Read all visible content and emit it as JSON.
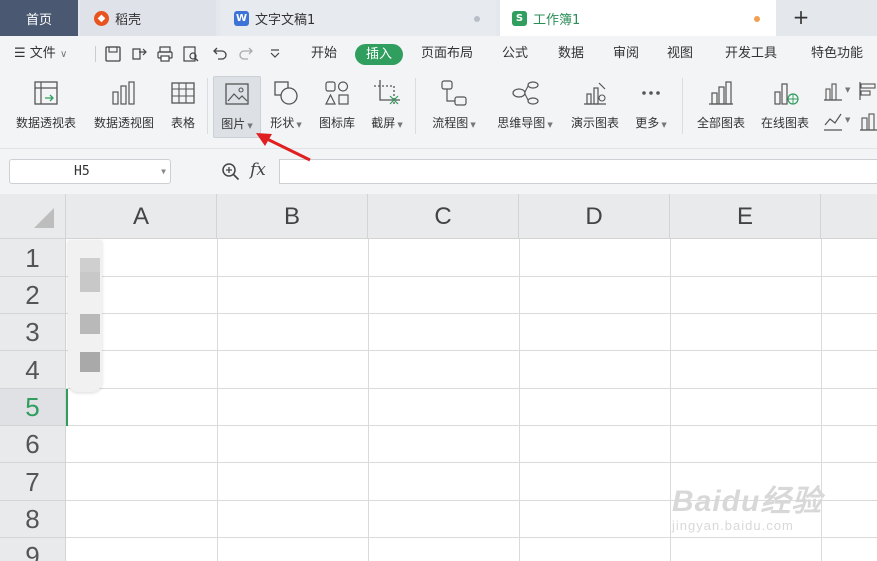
{
  "tabs": [
    {
      "label": "首页",
      "icon": "home"
    },
    {
      "label": "稻壳",
      "icon": "daoke-logo-icon",
      "icon_color": "#e8531f"
    },
    {
      "label": "文字文稿1",
      "icon": "writer-doc-icon",
      "icon_text": "W",
      "icon_color": "#3d73d6",
      "dot_color": "#b8bec7"
    },
    {
      "label": "工作簿1",
      "icon": "spreadsheet-icon",
      "icon_text": "S",
      "icon_color": "#2f9e5e",
      "dot_color": "#f0a050"
    }
  ],
  "tab_add_label": "+",
  "menu": {
    "file_label": "文件",
    "items": [
      "开始",
      "插入",
      "页面布局",
      "公式",
      "数据",
      "审阅",
      "视图",
      "开发工具",
      "特色功能"
    ],
    "active_item": "插入",
    "active_color": "#2f9e5e"
  },
  "ribbon": {
    "buttons": [
      {
        "label": "数据透视表",
        "icon": "pivot-table-icon"
      },
      {
        "label": "数据透视图",
        "icon": "pivot-chart-icon"
      },
      {
        "label": "表格",
        "icon": "table-icon"
      },
      {
        "label": "图片",
        "icon": "picture-icon",
        "has_dropdown": true
      },
      {
        "label": "形状",
        "icon": "shapes-icon",
        "has_dropdown": true
      },
      {
        "label": "图标库",
        "icon": "icon-library-icon"
      },
      {
        "label": "截屏",
        "icon": "screenshot-icon",
        "has_dropdown": true
      },
      {
        "label": "流程图",
        "icon": "flowchart-icon",
        "has_dropdown": true
      },
      {
        "label": "思维导图",
        "icon": "mindmap-icon",
        "has_dropdown": true
      },
      {
        "label": "演示图表",
        "icon": "demo-chart-icon"
      },
      {
        "label": "更多",
        "icon": "more-icon",
        "has_dropdown": true
      },
      {
        "label": "全部图表",
        "icon": "all-charts-icon"
      },
      {
        "label": "在线图表",
        "icon": "online-chart-icon"
      }
    ]
  },
  "formula_bar": {
    "name_box": "H5",
    "fx_label": "fx",
    "formula": ""
  },
  "sheet": {
    "columns": [
      "A",
      "B",
      "C",
      "D",
      "E"
    ],
    "rows": [
      "1",
      "2",
      "3",
      "4",
      "5",
      "6",
      "7",
      "8",
      "9"
    ],
    "active_row": "5",
    "accent_color": "#2f9e5e"
  },
  "watermark": {
    "main": "Baidu经验",
    "sub": "jingyan.baidu.com"
  },
  "annotation_color": "#e02020"
}
